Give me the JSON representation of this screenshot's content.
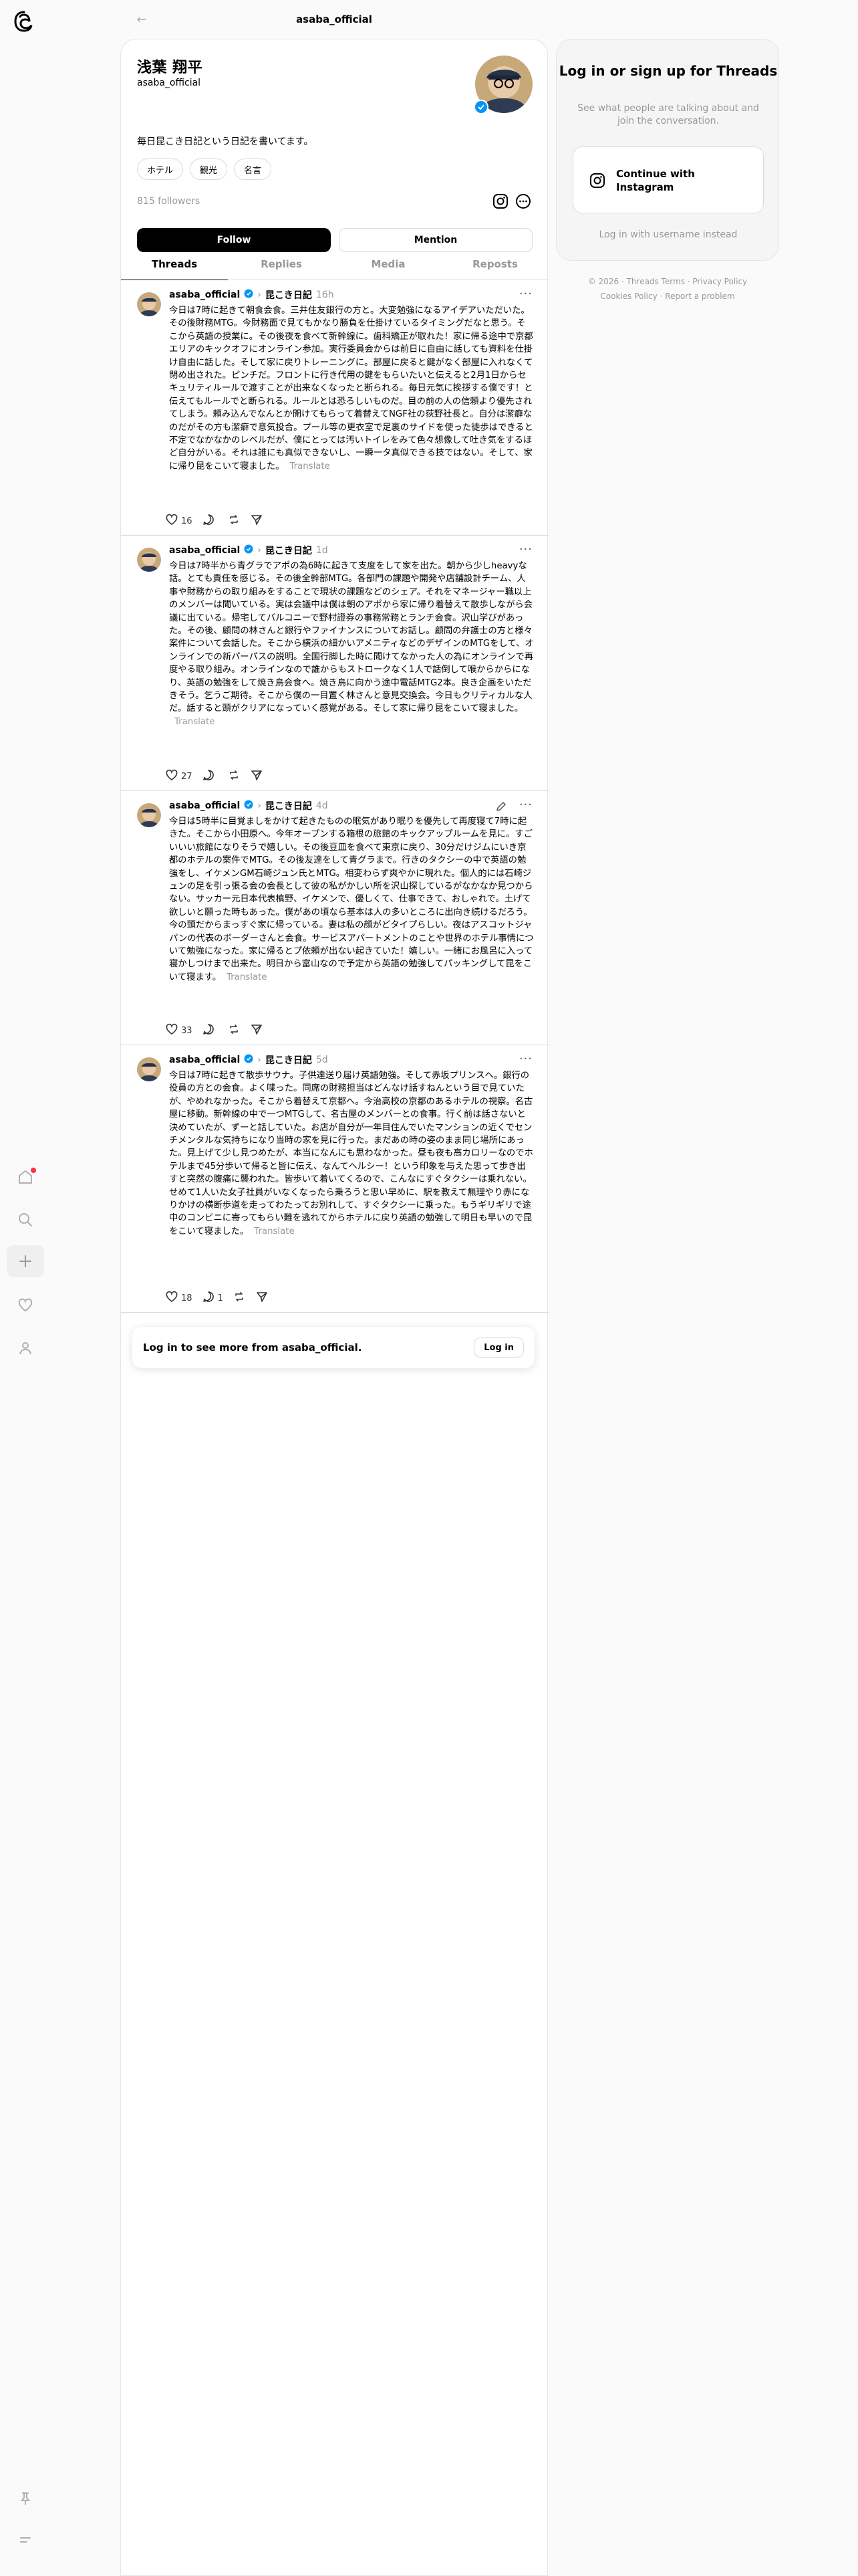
{
  "header": {
    "title": "asaba_official",
    "back_icon": "arrow-left-icon"
  },
  "nav": {
    "items": [
      {
        "name": "home-icon",
        "badge": true
      },
      {
        "name": "search-icon"
      },
      {
        "name": "create-icon"
      },
      {
        "name": "heart-icon"
      },
      {
        "name": "profile-icon"
      }
    ],
    "bottom": [
      "pin-icon",
      "menu-icon"
    ]
  },
  "profile": {
    "name": "浅葉 翔平",
    "handle": "asaba_official",
    "bio": "毎日昆こき日記という日記を書いてます。",
    "tags": [
      "ホテル",
      "観光",
      "名言"
    ],
    "followers": "815 followers",
    "follow_label": "Follow",
    "mention_label": "Mention"
  },
  "tabs": [
    "Threads",
    "Replies",
    "Media",
    "Reposts"
  ],
  "posts": [
    {
      "user": "asaba_official",
      "tag": "昆こき日記",
      "time": "16h",
      "text": "今日は7時に起きて朝食会食。三井住友銀行の方と。大変勉強になるアイデアいただいた。その後財務MTG。今財務面で見てもかなり勝負を仕掛けているタイミングだなと思う。そこから英語の授業に。その後夜を食べて新幹線に。歯科矯正が取れた！家に帰る途中で京都エリアのキックオフにオンライン参加。実行委員会からは前日に自由に話しても資料を仕掛け自由に話した。そして家に戻りトレーニングに。部屋に戻ると鍵がなく部屋に入れなくて閉め出された。ピンチだ。フロントに行き代用の鍵をもらいたいと伝えると2月1日からセキュリティルールで渡すことが出来なくなったと断られる。毎日元気に挨拶する僕です！と伝えてもルールでと断られる。ルールとは恐ろしいものだ。目の前の人の信頼より優先されてしまう。頼み込んでなんとか開けてもらって着替えてNGF社の荻野社長と。自分は潔癖なのだがその方も潔癖で意気投合。プール等の更衣室で足裏のサイドを使った徒歩はできると不定でなかなかのレベルだが、僕にとっては汚いトイレをみて色々想像して吐き気をするほど自分がいる。それは誰にも真似できないし、一瞬一タ真似できる技ではない。そして、家に帰り昆をこいて寝ました。",
      "translate": "Translate",
      "likes": "16",
      "replies": "",
      "edited": false
    },
    {
      "user": "asaba_official",
      "tag": "昆こき日記",
      "time": "1d",
      "text": "今日は7時半から青グラでアポの為6時に起きて支度をして家を出た。朝から少しheavyな話。とても責任を感じる。その後全幹部MTG。各部門の課題や開発や店舗設計チーム、人事や財務からの取り組みをすることで現状の課題などのシェア。それをマネージャー職以上のメンバーは聞いている。実は会議中は僕は朝のアポから家に帰り着替えて散歩しながら会議に出ている。帰宅してバルコニーで野村證券の事務常務とランチ会食。沢山学びがあった。その後、顧問の林さんと銀行やファイナンスについてお話し。顧問の弁護士の方と様々案件について会話した。そこから横浜の細かいアメニティなどのデザインのMTGをして、オンラインでの新パーパスの説明。全国行脚した時に聞けてなかった人の為にオンラインで再度やる取り組み。オンラインなので誰からもストロークなく1人で話倒して喉からからになり、英語の勉強をして焼き鳥会食へ。焼き鳥に向かう途中電話MTG2本。良き企画をいただきそう。乞うご期待。そこから僕の一目置く林さんと意見交換会。今日もクリティカルな人だ。話すると頭がクリアになっていく感覚がある。そして家に帰り昆をこいて寝ました。",
      "translate": "Translate",
      "likes": "27",
      "replies": "",
      "edited": false
    },
    {
      "user": "asaba_official",
      "tag": "昆こき日記",
      "time": "4d",
      "text": "今日は5時半に目覚ましをかけて起きたものの眠気があり眠りを優先して再度寝て7時に起きた。そこから小田原へ。今年オープンする箱根の旅館のキックアップルームを見に。すごいいい旅館になりそうで嬉しい。その後豆皿を食べて東京に戻り、30分だけジムにいき京都のホテルの案件でMTG。その後友達をして青グラまで。行きのタクシーの中で英語の勉強をし、イケメンGM石崎ジュン氏とMTG。相変わらず爽やかに現れた。個人的には石崎ジュンの足を引っ張る会の会長として彼の私がかしい所を沢山探しているがなかなか見つからない。サッカー元日本代表槙野、イケメンで、優しくて、仕事できて、おしゃれで。土げて欲しいと願った時もあった。僕があの頃なら基本は人の多いところに出向き続けるだろう。今の頭だからまっすぐ家に帰っている。妻は私の顔がどタイプらしい。夜はアスコットジャパンの代表のボーダーさんと会食。サービスアパートメントのことや世界のホテル事情について勉強になった。家に帰るとプ依頼が出ない起きていた！嬉しい。一緒にお風呂に入って寝かしつけまで出来た。明日から富山なので予定から英語の勉強してパッキングして昆をこいて寝ます。",
      "translate": "Translate",
      "likes": "33",
      "replies": "",
      "edited": true
    },
    {
      "user": "asaba_official",
      "tag": "昆こき日記",
      "time": "5d",
      "text": "今日は7時に起きて散歩サウナ。子供達送り届け英語勉強。そして赤坂プリンスへ。銀行の役員の方との会食。よく喋った。同席の財務担当はどんなけ話すねんという目で見ていたが、やめれなかった。そこから着替えて京都へ。今治高校の京都のあるホテルの視察。名古屋に移動。新幹線の中で一つMTGして、名古屋のメンバーとの食事。行く前は話さないと決めていたが、ずーと話していた。お店が自分が一年目住んでいたマンションの近くでセンチメンタルな気持ちになり当時の家を見に行った。まだあの時の姿のまま同じ場所にあった。見上げて少し見つめたが、本当になんにも思わなかった。昼も夜も高カロリーなのでホテルまで45分歩いて帰ると皆に伝え、なんてヘルシー！という印象を与えた思って歩き出すと突然の腹痛に襲われた。皆歩いて着いてくるので、こんなにすぐタクシーは乗れない。せめて1人いた女子社員がいなくなったら乗ろうと思い早めに、駅を教えて無理やり赤になりかけの横断歩道を走ってわたってお別れして、すぐタクシーに乗った。もうギリギリで途中のコンビニに寄ってもらい難を逃れてからホテルに戻り英語の勉強して明日も早いので昆をこいて寝ました。",
      "translate": "Translate",
      "likes": "18",
      "replies": "1",
      "edited": false
    }
  ],
  "login_bar": {
    "text": "Log in to see more from asaba_official.",
    "button": "Log in"
  },
  "sidebar": {
    "title": "Log in or sign up for Threads",
    "subtitle": "See what people are talking about and join the conversation.",
    "instagram_label": "Continue with Instagram",
    "alt_login": "Log in with username instead"
  },
  "footer": {
    "line1": "© 2026 · Threads Terms · Privacy Policy",
    "line2": "Cookies Policy · Report a problem"
  },
  "colors": {
    "accent": "#000000",
    "muted": "#999999",
    "badge": "#ff3040",
    "verified": "#0095f6"
  }
}
